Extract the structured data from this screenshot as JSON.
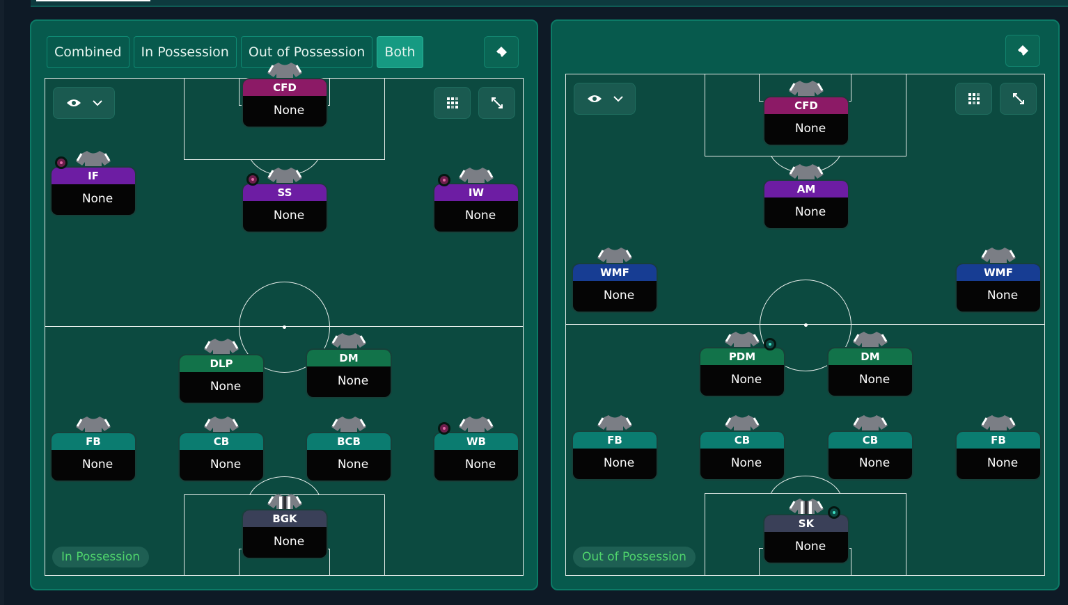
{
  "colors": {
    "panel": "#075a4d",
    "pitch": "#0c4a40",
    "attack": "#6d1da3",
    "striker": "#8c1a66",
    "wide_mid": "#173d93",
    "midfield": "#12734a",
    "defense": "#0b7c70",
    "goalkeeper": "#3a4058",
    "phase_text": "#4fd46c"
  },
  "icons": {
    "clear": "eraser-icon",
    "visibility": "eye-icon",
    "dropdown": "chevron-down-icon",
    "grid": "grid-icon",
    "expand": "expand-icon",
    "shirt": "shirt-icon",
    "trait": "trait-gem-icon"
  },
  "tabs": [
    {
      "label": "Combined"
    },
    {
      "label": "In Possession"
    },
    {
      "label": "Out of Possession"
    },
    {
      "label": "Both"
    }
  ],
  "active_tab": "Both",
  "left": {
    "phase": "In Possession",
    "players": [
      {
        "role": "CFD",
        "name": "None"
      },
      {
        "role": "IF",
        "name": "None"
      },
      {
        "role": "SS",
        "name": "None"
      },
      {
        "role": "IW",
        "name": "None"
      },
      {
        "role": "DLP",
        "name": "None"
      },
      {
        "role": "DM",
        "name": "None"
      },
      {
        "role": "FB",
        "name": "None"
      },
      {
        "role": "CB",
        "name": "None"
      },
      {
        "role": "BCB",
        "name": "None"
      },
      {
        "role": "WB",
        "name": "None"
      },
      {
        "role": "BGK",
        "name": "None"
      }
    ]
  },
  "right": {
    "phase": "Out of Possession",
    "players": [
      {
        "role": "CFD",
        "name": "None"
      },
      {
        "role": "AM",
        "name": "None"
      },
      {
        "role": "WMF",
        "name": "None"
      },
      {
        "role": "WMF",
        "name": "None"
      },
      {
        "role": "PDM",
        "name": "None"
      },
      {
        "role": "DM",
        "name": "None"
      },
      {
        "role": "FB",
        "name": "None"
      },
      {
        "role": "CB",
        "name": "None"
      },
      {
        "role": "CB",
        "name": "None"
      },
      {
        "role": "FB",
        "name": "None"
      },
      {
        "role": "SK",
        "name": "None"
      }
    ]
  }
}
